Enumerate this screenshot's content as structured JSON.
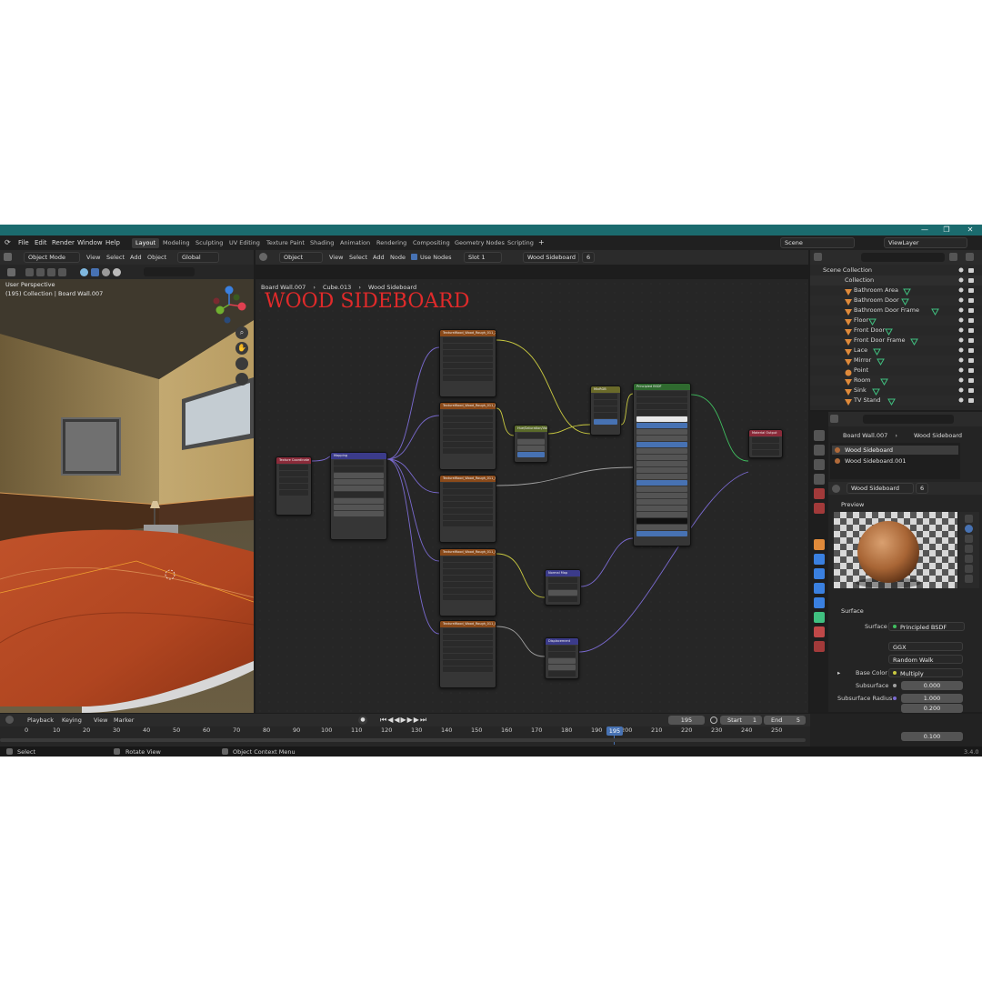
{
  "window": {
    "min": "—",
    "max": "❐",
    "close": "✕"
  },
  "menu": [
    "File",
    "Edit",
    "Render",
    "Window",
    "Help"
  ],
  "workspaces": [
    "Layout",
    "Modeling",
    "Sculpting",
    "UV Editing",
    "Texture Paint",
    "Shading",
    "Animation",
    "Rendering",
    "Compositing",
    "Geometry Nodes",
    "Scripting"
  ],
  "add_tab": "+",
  "scene": {
    "name": "Scene",
    "viewlayer": "ViewLayer"
  },
  "viewport_header": {
    "mode": "Object Mode",
    "items": [
      "View",
      "Select",
      "Add",
      "Object"
    ],
    "transform": "Global"
  },
  "viewport": {
    "perspective": "User Perspective",
    "info": "(195) Collection | Board Wall.007"
  },
  "node_header": {
    "type": "Object",
    "items": [
      "View",
      "Select",
      "Add",
      "Node"
    ],
    "use_nodes": "Use Nodes",
    "slot": "Slot 1",
    "material": "Wood Sideboard",
    "users": "6"
  },
  "breadcrumb": {
    "a": "Board Wall.007",
    "b": "Cube.013",
    "c": "Wood Sideboard"
  },
  "node_title": "WOOD SIDEBOARD",
  "outliner": {
    "root": "Scene Collection",
    "collection": "Collection",
    "items": [
      "Bathroom Area",
      "Bathroom Door",
      "Bathroom Door Frame",
      "Floor",
      "Front Door",
      "Front Door Frame",
      "Lace",
      "Mirror",
      "Point",
      "Room",
      "Sink",
      "TV Stand"
    ]
  },
  "props": {
    "crumb_obj": "Board Wall.007",
    "crumb_mat": "Wood Sideboard",
    "slots": [
      "Wood Sideboard",
      "Wood Sideboard.001"
    ],
    "material": "Wood Sideboard",
    "users": "6",
    "preview_label": "Preview",
    "surface_panel": "Surface",
    "surface_label": "Surface",
    "surface_value": "Principled BSDF",
    "distribution": "GGX",
    "subsurface_method": "Random Walk",
    "base_color_label": "Base Color",
    "base_color_value": "Multiply",
    "subsurface_label": "Subsurface",
    "subsurface_value": "0.000",
    "radius_label": "Subsurface Radius",
    "radius": [
      "1.000",
      "0.200",
      "0.100"
    ]
  },
  "timeline": {
    "items": [
      "Playback",
      "Keying",
      "View",
      "Marker"
    ],
    "frame": "195",
    "start_label": "Start",
    "start": "1",
    "end_label": "End",
    "end": "5",
    "ticks": [
      "0",
      "10",
      "20",
      "30",
      "40",
      "50",
      "60",
      "70",
      "80",
      "90",
      "100",
      "110",
      "120",
      "130",
      "140",
      "150",
      "160",
      "170",
      "180",
      "190",
      "200",
      "210",
      "220",
      "230",
      "240",
      "250"
    ],
    "current": "195"
  },
  "status": {
    "select": "Select",
    "rotate": "Rotate View",
    "context": "Object Context Menu",
    "version": "3.4.0"
  },
  "nodes": {
    "tex_coord": "Texture Coordinate",
    "mapping": "Mapping",
    "img1": "TextureWood_Wood_Rough_011_2K_COLOR",
    "img2": "TextureWood_Wood_Rough_011_ROUGH",
    "img3": "TextureWood_Wood_Rough_011_GLOSS",
    "img4": "TextureWood_Wood_Rough_011_NRM",
    "img5": "TextureWood_Wood_Rough_011_DISP",
    "hue": "Hue/Saturation/Value",
    "mix": "MixRGB",
    "bsdf": "Principled BSDF",
    "output": "Material Output",
    "normal": "Normal Map",
    "disp": "Displacement"
  },
  "colors": {
    "accent": "#4772b3",
    "title_red": "#e02a2a",
    "titlebar": "#1b6b6e"
  }
}
